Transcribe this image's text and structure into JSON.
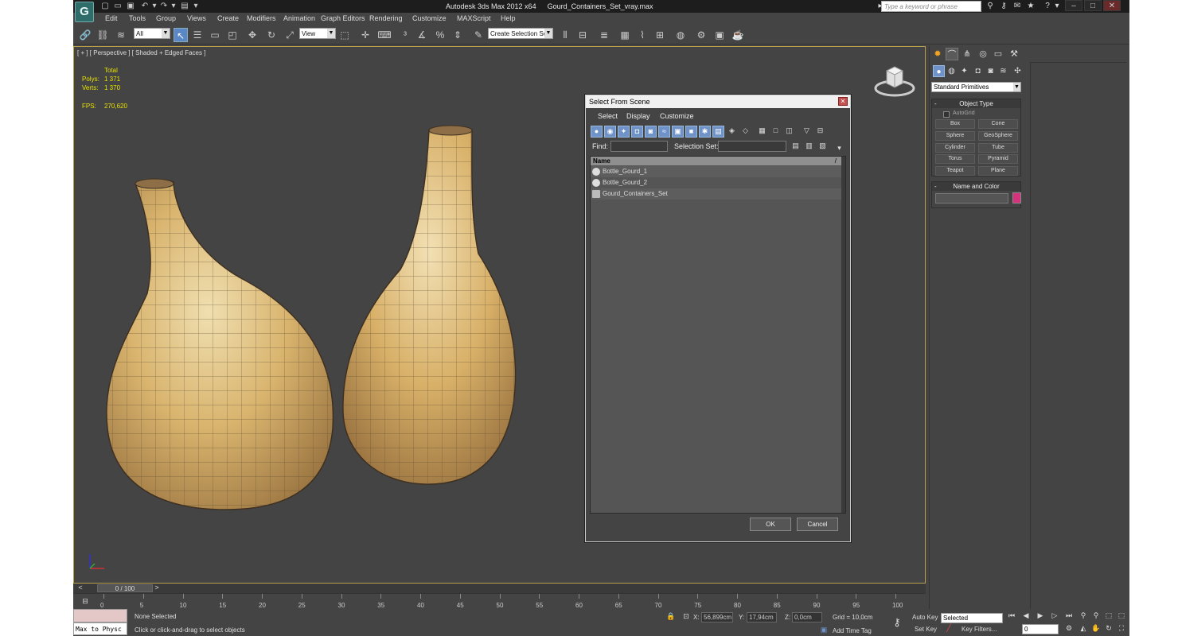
{
  "window": {
    "app_title": "Autodesk 3ds Max  2012 x64",
    "file_name": "Gourd_Containers_Set_vray.max",
    "search_placeholder": "Type a keyword or phrase",
    "logo_letter": "G"
  },
  "menu": [
    "Edit",
    "Tools",
    "Group",
    "Views",
    "Create",
    "Modifiers",
    "Animation",
    "Graph Editors",
    "Rendering",
    "Customize",
    "MAXScript",
    "Help"
  ],
  "toolbar": {
    "selection_filter": "All",
    "reference_coord": "View",
    "named_selection": "Create Selection Se"
  },
  "viewport": {
    "label": "[ + ] [ Perspective ] [ Shaded + Edged Faces ]",
    "stats_header": "Total",
    "polys_label": "Polys:",
    "polys_value": "1 371",
    "verts_label": "Verts:",
    "verts_value": "1 370",
    "fps_label": "FPS:",
    "fps_value": "270,620"
  },
  "dialog": {
    "title": "Select From Scene",
    "menus": [
      "Select",
      "Display",
      "Customize"
    ],
    "find_label": "Find:",
    "selection_set_label": "Selection Set:",
    "column_name": "Name",
    "sort_arrow": "/",
    "items": [
      {
        "name": "Bottle_Gourd_1",
        "type": "mesh"
      },
      {
        "name": "Bottle_Gourd_2",
        "type": "mesh"
      },
      {
        "name": "Gourd_Containers_Set",
        "type": "group"
      }
    ],
    "ok_label": "OK",
    "cancel_label": "Cancel"
  },
  "timeline": {
    "slider": "0 / 100",
    "ticks": [
      "0",
      "5",
      "10",
      "15",
      "20",
      "25",
      "30",
      "35",
      "40",
      "45",
      "50",
      "55",
      "60",
      "65",
      "70",
      "75",
      "80",
      "85",
      "90",
      "95",
      "100"
    ]
  },
  "status": {
    "maxscript_text": "Max to Physc",
    "selection_status": "None Selected",
    "prompt": "Click or click-and-drag to select objects",
    "x_label": "X:",
    "x_value": "56,899cm",
    "y_label": "Y:",
    "y_value": "17,94cm",
    "z_label": "Z:",
    "z_value": "0,0cm",
    "grid": "Grid = 10,0cm",
    "add_time_tag": "Add Time Tag",
    "auto_key": "Auto Key",
    "selected_dropdown": "Selected",
    "set_key": "Set Key",
    "key_filters": "Key Filters...",
    "frame": "0"
  },
  "command_panel": {
    "primitive_type": "Standard Primitives",
    "object_type_title": "Object Type",
    "autogrid": "AutoGrid",
    "buttons": [
      "Box",
      "Cone",
      "Sphere",
      "GeoSphere",
      "Cylinder",
      "Tube",
      "Torus",
      "Pyramid",
      "Teapot",
      "Plane"
    ],
    "name_color_title": "Name and Color",
    "color_swatch": "#d6327e"
  },
  "colors": {
    "viewport_border": "#b8a04a",
    "stats_yellow": "#e8e300",
    "selection_blue": "#6f93c9"
  }
}
